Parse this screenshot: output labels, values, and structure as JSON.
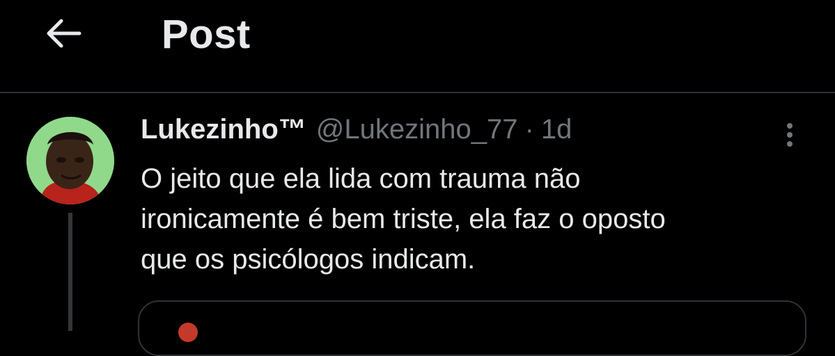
{
  "header": {
    "back_icon": "arrow-left-icon",
    "title": "Post"
  },
  "tweet": {
    "avatar_icon": "user-avatar",
    "display_name": "Lukezinho™",
    "handle": "@Lukezinho_77",
    "separator": "·",
    "time": "1d",
    "more_icon": "more-vertical-icon",
    "text_lines": [
      "O jeito que ela lida com trauma não",
      "ironicamente é bem triste, ela faz o oposto",
      "que os psicólogos indicam."
    ]
  },
  "colors": {
    "background": "#000000",
    "primary_text": "#e7e9ea",
    "secondary_text": "#71767b",
    "divider": "#2f3336"
  }
}
